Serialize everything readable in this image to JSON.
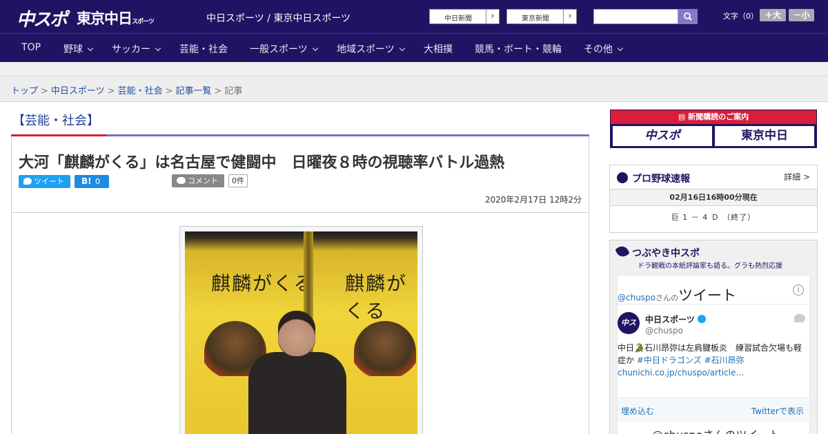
{
  "header": {
    "logo_chuspo": "中スポ",
    "logo_tokyo": "東京中日",
    "logo_tokyo_small": "スポーツ",
    "site_title": "中日スポーツ / 東京中日スポーツ",
    "link_chunichi": "中日新聞",
    "link_tokyo": "東京新聞",
    "search_placeholder": "",
    "font_size_label": "文字（0）",
    "font_plus": "＋大",
    "font_minus": "－小"
  },
  "nav": {
    "items": [
      {
        "label": "TOP"
      },
      {
        "label": "野球"
      },
      {
        "label": "サッカー"
      },
      {
        "label": "芸能・社会"
      },
      {
        "label": "一般スポーツ"
      },
      {
        "label": "地域スポーツ"
      },
      {
        "label": "大相撲"
      },
      {
        "label": "競馬・ボート・競輪"
      },
      {
        "label": "その他"
      }
    ]
  },
  "breadcrumb": {
    "items": [
      "トップ",
      "中日スポーツ",
      "芸能・社会",
      "記事一覧"
    ],
    "current": "記事",
    "separator": ">"
  },
  "article": {
    "category": "【芸能・社会】",
    "headline": "大河「麒麟がくる」は名古屋で健闘中　日曜夜８時の視聴率バトル過熱",
    "tweet_label": "ツイート",
    "hatena_label": "B!",
    "hatena_count": "0",
    "comment_label": "コメント",
    "comment_count": "0件",
    "date": "2020年2月17日 12時2分",
    "photo_poster_text": "麒麟がくる"
  },
  "sidebar": {
    "subscribe": {
      "header": "新聞購読のご案内",
      "logo_chuspo": "中スポ",
      "logo_tokyo": "東京中日"
    },
    "baseball": {
      "title": "プロ野球速報",
      "detail": "詳細 >",
      "time": "02月16日16時00分現在",
      "score": "巨 1 － 4 Ｄ （終了）"
    },
    "tweets": {
      "title": "つぶやき中スポ",
      "subtitle": "ドラ観戦の本紙評論家も語る。グラも熱烈応援",
      "handle": "@chuspo",
      "handle_suffix": "さんの",
      "tweets_word": "ツイート",
      "account_name": "中日スポーツ",
      "account_handle": "@chuspo",
      "avatar_text": "中スポ",
      "tweet_text": "中日🐊石川昂弥は左肩腱板炎　練習試合欠場も軽症か",
      "hashtag1": "#中日ドラゴンズ",
      "hashtag2": "#石川昂弥",
      "link": "chunichi.co.jp/chuspo/article…",
      "embed_label": "埋め込む",
      "view_on_twitter": "Twitterで表示",
      "next_heading": "@chuspoさんのツイート"
    }
  },
  "colors": {
    "header_bg": "#1f1463",
    "accent_red": "#d91e3a",
    "link_blue": "#1f4fa0",
    "twitter_blue": "#1da1f2"
  }
}
